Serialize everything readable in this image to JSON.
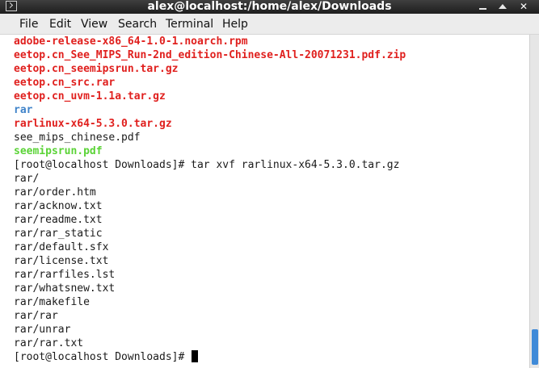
{
  "window": {
    "title": "alex@localhost:/home/alex/Downloads",
    "app_icon": "terminal-icon",
    "buttons": {
      "minimize": "minimize",
      "maximize": "maximize",
      "close": "✕"
    }
  },
  "menubar": {
    "items": [
      "File",
      "Edit",
      "View",
      "Search",
      "Terminal",
      "Help"
    ]
  },
  "terminal": {
    "lines": [
      {
        "text": "adobe-release-x86_64-1.0-1.noarch.rpm",
        "color": "red"
      },
      {
        "text": "eetop.cn_See_MIPS_Run-2nd_edition-Chinese-All-20071231.pdf.zip",
        "color": "red"
      },
      {
        "text": "eetop.cn_seemipsrun.tar.gz",
        "color": "red"
      },
      {
        "text": "eetop.cn_src.rar",
        "color": "red"
      },
      {
        "text": "eetop.cn_uvm-1.1a.tar.gz",
        "color": "red"
      },
      {
        "text": "rar",
        "color": "blue"
      },
      {
        "text": "rarlinux-x64-5.3.0.tar.gz",
        "color": "red"
      },
      {
        "text": "see_mips_chinese.pdf",
        "color": "default"
      },
      {
        "text": "seemipsrun.pdf",
        "color": "green"
      },
      {
        "text": "[root@localhost Downloads]# tar xvf rarlinux-x64-5.3.0.tar.gz",
        "color": "default"
      },
      {
        "text": "rar/",
        "color": "default"
      },
      {
        "text": "rar/order.htm",
        "color": "default"
      },
      {
        "text": "rar/acknow.txt",
        "color": "default"
      },
      {
        "text": "rar/readme.txt",
        "color": "default"
      },
      {
        "text": "rar/rar_static",
        "color": "default"
      },
      {
        "text": "rar/default.sfx",
        "color": "default"
      },
      {
        "text": "rar/license.txt",
        "color": "default"
      },
      {
        "text": "rar/rarfiles.lst",
        "color": "default"
      },
      {
        "text": "rar/whatsnew.txt",
        "color": "default"
      },
      {
        "text": "rar/makefile",
        "color": "default"
      },
      {
        "text": "rar/rar",
        "color": "default"
      },
      {
        "text": "rar/unrar",
        "color": "default"
      },
      {
        "text": "rar/rar.txt",
        "color": "default"
      }
    ],
    "prompt": "[root@localhost Downloads]# "
  },
  "colors": {
    "red": "#e0201e",
    "blue": "#3f83c9",
    "green": "#5ad336",
    "scroll_thumb": "#3f8ad8"
  }
}
